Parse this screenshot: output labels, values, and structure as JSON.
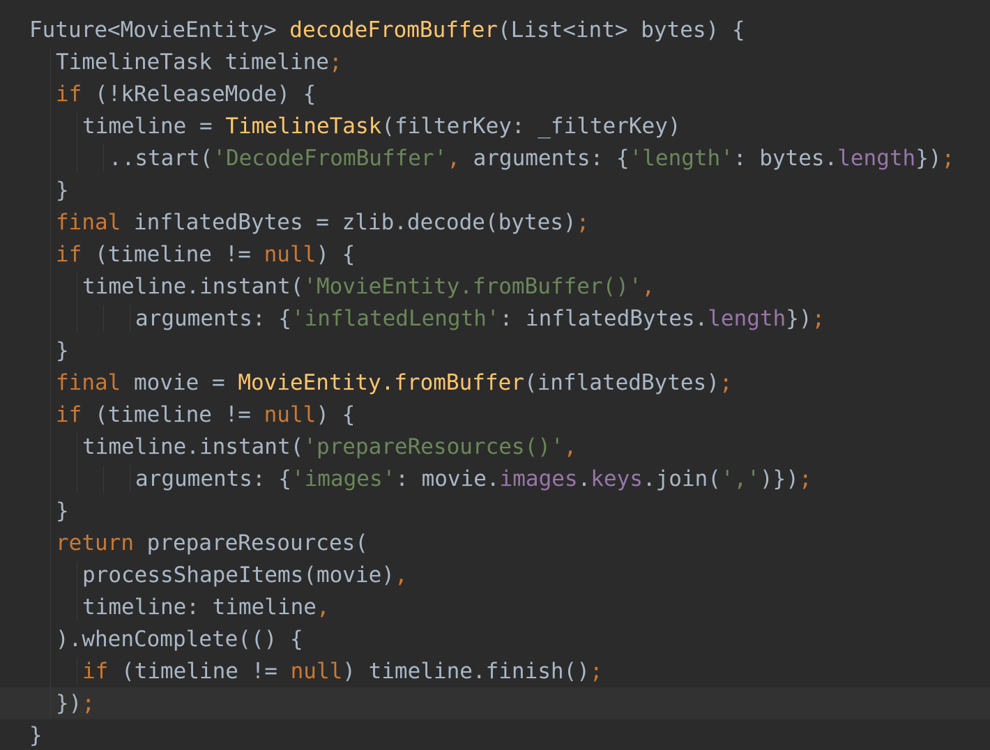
{
  "editor": {
    "language": "dart",
    "current_line_index": 21,
    "colors": {
      "background": "#2b2b2b",
      "current_line": "#323232",
      "plain": "#a9b7c6",
      "keyword": "#cc7832",
      "function": "#ffc66d",
      "string": "#6a8759",
      "field": "#9876aa"
    },
    "lines": [
      {
        "indent": 0,
        "tokens": [
          {
            "t": "pl",
            "v": "Future<MovieEntity> "
          },
          {
            "t": "fn",
            "v": "decodeFromBuffer"
          },
          {
            "t": "pl",
            "v": "(List<int> bytes) {"
          }
        ]
      },
      {
        "indent": 1,
        "tokens": [
          {
            "t": "pl",
            "v": "TimelineTask timeline"
          },
          {
            "t": "sep",
            "v": ";"
          }
        ]
      },
      {
        "indent": 1,
        "tokens": [
          {
            "t": "kw",
            "v": "if"
          },
          {
            "t": "pl",
            "v": " (!kReleaseMode) {"
          }
        ]
      },
      {
        "indent": 2,
        "tokens": [
          {
            "t": "pl",
            "v": "timeline = "
          },
          {
            "t": "fn",
            "v": "TimelineTask"
          },
          {
            "t": "pl",
            "v": "(filterKey: _filterKey)"
          }
        ]
      },
      {
        "indent": 3,
        "tokens": [
          {
            "t": "pl",
            "v": "..start("
          },
          {
            "t": "str",
            "v": "'DecodeFromBuffer'"
          },
          {
            "t": "sep",
            "v": ","
          },
          {
            "t": "pl",
            "v": " arguments: {"
          },
          {
            "t": "str",
            "v": "'length'"
          },
          {
            "t": "pl",
            "v": ": bytes."
          },
          {
            "t": "fld",
            "v": "length"
          },
          {
            "t": "pl",
            "v": "})"
          },
          {
            "t": "sep",
            "v": ";"
          }
        ]
      },
      {
        "indent": 1,
        "tokens": [
          {
            "t": "pl",
            "v": "}"
          }
        ]
      },
      {
        "indent": 1,
        "tokens": [
          {
            "t": "kw",
            "v": "final"
          },
          {
            "t": "pl",
            "v": " inflatedBytes = zlib.decode(bytes)"
          },
          {
            "t": "sep",
            "v": ";"
          }
        ]
      },
      {
        "indent": 1,
        "tokens": [
          {
            "t": "kw",
            "v": "if"
          },
          {
            "t": "pl",
            "v": " (timeline != "
          },
          {
            "t": "kw",
            "v": "null"
          },
          {
            "t": "pl",
            "v": ") {"
          }
        ]
      },
      {
        "indent": 2,
        "tokens": [
          {
            "t": "pl",
            "v": "timeline.instant("
          },
          {
            "t": "str",
            "v": "'MovieEntity.fromBuffer()'"
          },
          {
            "t": "sep",
            "v": ","
          }
        ]
      },
      {
        "indent": 4,
        "tokens": [
          {
            "t": "pl",
            "v": "arguments: {"
          },
          {
            "t": "str",
            "v": "'inflatedLength'"
          },
          {
            "t": "pl",
            "v": ": inflatedBytes."
          },
          {
            "t": "fld",
            "v": "length"
          },
          {
            "t": "pl",
            "v": "})"
          },
          {
            "t": "sep",
            "v": ";"
          }
        ]
      },
      {
        "indent": 1,
        "tokens": [
          {
            "t": "pl",
            "v": "}"
          }
        ]
      },
      {
        "indent": 1,
        "tokens": [
          {
            "t": "kw",
            "v": "final"
          },
          {
            "t": "pl",
            "v": " movie = "
          },
          {
            "t": "fn",
            "v": "MovieEntity.fromBuffer"
          },
          {
            "t": "pl",
            "v": "(inflatedBytes)"
          },
          {
            "t": "sep",
            "v": ";"
          }
        ]
      },
      {
        "indent": 1,
        "tokens": [
          {
            "t": "kw",
            "v": "if"
          },
          {
            "t": "pl",
            "v": " (timeline != "
          },
          {
            "t": "kw",
            "v": "null"
          },
          {
            "t": "pl",
            "v": ") {"
          }
        ]
      },
      {
        "indent": 2,
        "tokens": [
          {
            "t": "pl",
            "v": "timeline.instant("
          },
          {
            "t": "str",
            "v": "'prepareResources()'"
          },
          {
            "t": "sep",
            "v": ","
          }
        ]
      },
      {
        "indent": 4,
        "tokens": [
          {
            "t": "pl",
            "v": "arguments: {"
          },
          {
            "t": "str",
            "v": "'images'"
          },
          {
            "t": "pl",
            "v": ": movie."
          },
          {
            "t": "fld",
            "v": "images"
          },
          {
            "t": "pl",
            "v": "."
          },
          {
            "t": "fld",
            "v": "keys"
          },
          {
            "t": "pl",
            "v": ".join("
          },
          {
            "t": "str",
            "v": "','"
          },
          {
            "t": "pl",
            "v": ")})"
          },
          {
            "t": "sep",
            "v": ";"
          }
        ]
      },
      {
        "indent": 1,
        "tokens": [
          {
            "t": "pl",
            "v": "}"
          }
        ]
      },
      {
        "indent": 1,
        "tokens": [
          {
            "t": "kw",
            "v": "return"
          },
          {
            "t": "pl",
            "v": " prepareResources("
          }
        ]
      },
      {
        "indent": 2,
        "tokens": [
          {
            "t": "pl",
            "v": "processShapeItems(movie)"
          },
          {
            "t": "sep",
            "v": ","
          }
        ]
      },
      {
        "indent": 2,
        "tokens": [
          {
            "t": "pl",
            "v": "timeline: timeline"
          },
          {
            "t": "sep",
            "v": ","
          }
        ]
      },
      {
        "indent": 1,
        "tokens": [
          {
            "t": "pl",
            "v": ").whenComplete(() {"
          }
        ]
      },
      {
        "indent": 2,
        "tokens": [
          {
            "t": "kw",
            "v": "if"
          },
          {
            "t": "pl",
            "v": " (timeline != "
          },
          {
            "t": "kw",
            "v": "null"
          },
          {
            "t": "pl",
            "v": ") timeline.finish()"
          },
          {
            "t": "sep",
            "v": ";"
          }
        ]
      },
      {
        "indent": 1,
        "tokens": [
          {
            "t": "pl",
            "v": "})"
          },
          {
            "t": "sep",
            "v": ";"
          }
        ]
      },
      {
        "indent": 0,
        "tokens": [
          {
            "t": "pl",
            "v": "}"
          }
        ]
      }
    ]
  }
}
